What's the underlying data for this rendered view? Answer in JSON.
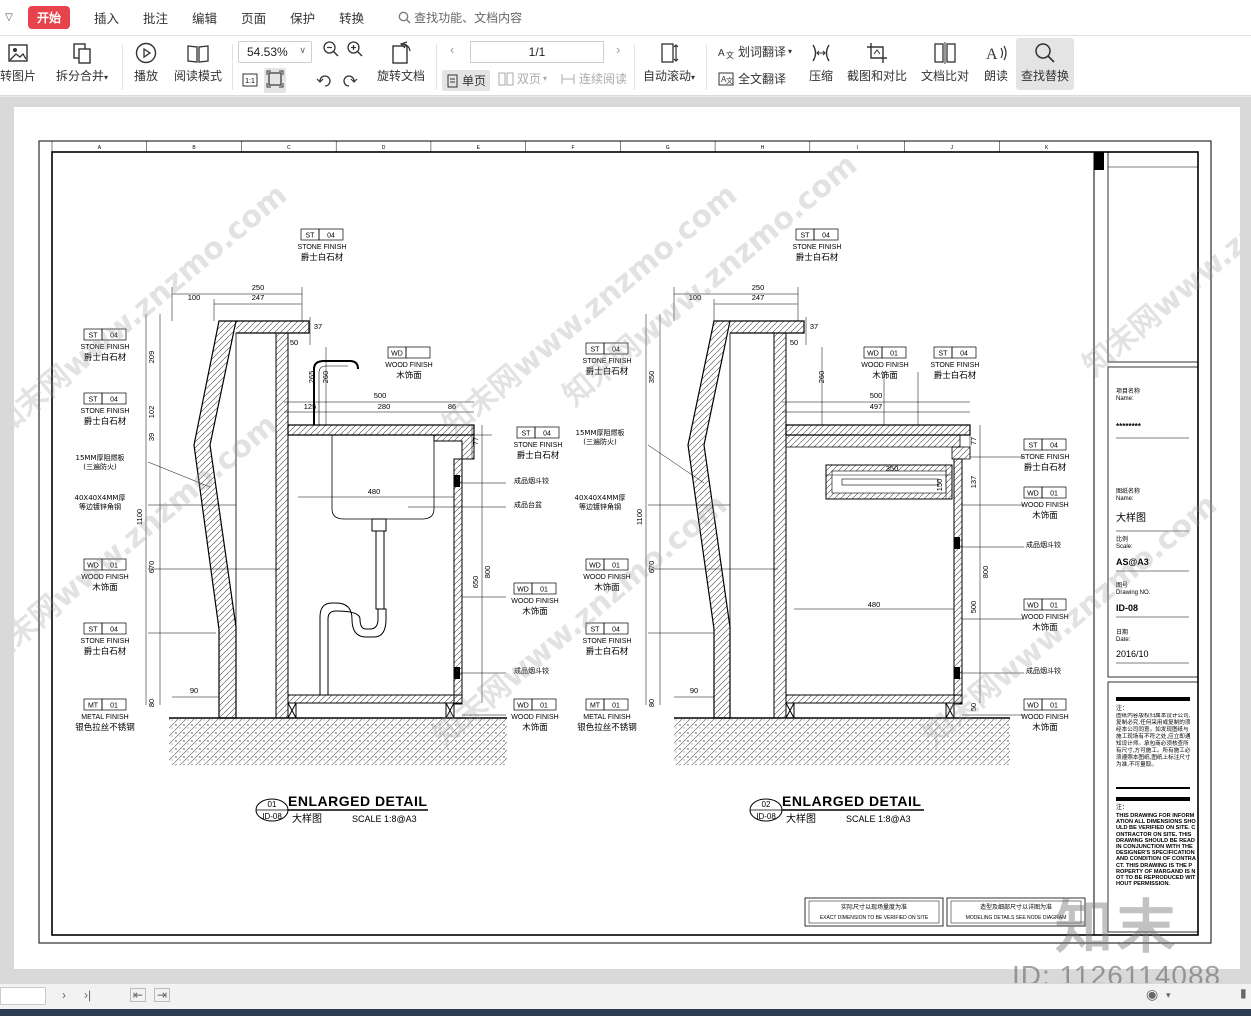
{
  "menubar": {
    "start": "开始",
    "items": [
      "插入",
      "批注",
      "编辑",
      "页面",
      "保护",
      "转换"
    ],
    "search_placeholder": "查找功能、文档内容"
  },
  "ribbon": {
    "to_image": "转图片",
    "split_merge": "拆分合并",
    "play": "播放",
    "read_mode": "阅读模式",
    "zoom": "54.53%",
    "rotate_doc": "旋转文档",
    "page_indicator": "1/1",
    "single_page": "单页",
    "double_page": "双页",
    "continuous": "连续阅读",
    "auto_scroll": "自动滚动",
    "word_translate": "划词翻译",
    "full_translate": "全文翻译",
    "compress": "压缩",
    "screenshot_compare": "截图和对比",
    "doc_compare": "文档比对",
    "read_aloud": "朗读",
    "find_replace": "查找替换"
  },
  "drawing": {
    "grid_letters": [
      "A",
      "B",
      "C",
      "D",
      "E",
      "F",
      "G",
      "H",
      "I",
      "J",
      "K"
    ],
    "watermark": "知末网www.znzmo.com",
    "details": [
      {
        "number": "01",
        "sheet": "ID-08",
        "title": "ENLARGED DETAIL",
        "subtitle": "大样图",
        "scale": "SCALE 1:8@A3",
        "dims": {
          "top_total": "250",
          "top_inner": "247",
          "top_left": "100",
          "h37": "37",
          "w50": "50",
          "w500": "500",
          "w125": "125",
          "w280": "280",
          "w86": "86",
          "w480": "480",
          "h209": "209",
          "h102": "102",
          "h39": "39",
          "h1100": "1100",
          "h670": "670",
          "h80": "80",
          "w90": "90",
          "h800": "800",
          "h650": "650",
          "h77": "77",
          "h265": "265",
          "h260": "260"
        },
        "left_tags": [
          {
            "code": "ST",
            "num": "04",
            "en": "STONE FINISH",
            "cn": "爵士白石材"
          },
          {
            "code": "ST",
            "num": "04",
            "en": "STONE FINISH",
            "cn": "爵士白石材"
          },
          {
            "code": "WD",
            "num": "01",
            "en": "WOOD FINISH",
            "cn": "木饰面"
          },
          {
            "code": "ST",
            "num": "04",
            "en": "STONE FINISH",
            "cn": "爵士白石材"
          },
          {
            "code": "MT",
            "num": "01",
            "en": "METAL FINISH",
            "cn": "银色拉丝不锈钢"
          }
        ],
        "left_notes": [
          "15MM厚阻燃板",
          "(三遍防火)",
          "40X40X4MM厚",
          "等边镀锌角钢"
        ],
        "right_tags": [
          {
            "code": "ST",
            "num": "04",
            "en": "STONE FINISH",
            "cn": "爵士白石材"
          },
          {
            "code": "WD",
            "num": "01",
            "en": "WOOD FINISH",
            "cn": "木饰面"
          },
          {
            "code": "WD",
            "num": "01",
            "en": "WOOD FINISH",
            "cn": "木饰面"
          }
        ],
        "right_notes": [
          "成品烟斗铰",
          "成品台盆",
          "成品烟斗铰"
        ],
        "top_tag": {
          "code": "ST",
          "num": "04",
          "en": "STONE FINISH",
          "cn": "爵士白石材"
        },
        "faucet_tag": {
          "code": "WD",
          "num": "",
          "en": "WOOD FINISH",
          "cn": "木饰面"
        }
      },
      {
        "number": "02",
        "sheet": "ID-08",
        "title": "ENLARGED DETAIL",
        "subtitle": "大样图",
        "scale": "SCALE 1:8@A3",
        "dims": {
          "top_total": "250",
          "top_inner": "247",
          "top_left": "100",
          "h37": "37",
          "w50": "50",
          "w500": "500",
          "w497": "497",
          "w350": "350",
          "w480": "480",
          "h350": "350",
          "h1100": "1100",
          "h670": "670",
          "h80": "80",
          "w90": "90",
          "h800": "800",
          "h500": "500",
          "h77": "77",
          "h137": "137",
          "h150": "150",
          "h50": "50",
          "h260": "260"
        },
        "left_tags": [
          {
            "code": "ST",
            "num": "04",
            "en": "STONE FINISH",
            "cn": "爵士白石材"
          },
          {
            "code": "WD",
            "num": "01",
            "en": "WOOD FINISH",
            "cn": "木饰面"
          },
          {
            "code": "ST",
            "num": "04",
            "en": "STONE FINISH",
            "cn": "爵士白石材"
          },
          {
            "code": "MT",
            "num": "01",
            "en": "METAL FINISH",
            "cn": "银色拉丝不锈钢"
          }
        ],
        "left_notes": [
          "15MM厚阻燃板",
          "(三遍防火)",
          "40X40X4MM厚",
          "等边镀锌角钢"
        ],
        "right_tags": [
          {
            "code": "ST",
            "num": "04",
            "en": "STONE FINISH",
            "cn": "爵士白石材"
          },
          {
            "code": "WD",
            "num": "01",
            "en": "WOOD FINISH",
            "cn": "木饰面"
          },
          {
            "code": "WD",
            "num": "01",
            "en": "WOOD FINISH",
            "cn": "木饰面"
          },
          {
            "code": "WD",
            "num": "01",
            "en": "WOOD FINISH",
            "cn": "木饰面"
          }
        ],
        "right_notes": [
          "成品烟斗铰",
          "成品烟斗铰"
        ],
        "top_tag": {
          "code": "ST",
          "num": "04",
          "en": "STONE FINISH",
          "cn": "爵士白石材"
        },
        "mid_tags": [
          {
            "code": "WD",
            "num": "01",
            "en": "WOOD FINISH",
            "cn": "木饰面"
          },
          {
            "code": "ST",
            "num": "04",
            "en": "STONE FINISH",
            "cn": "爵士白石材"
          }
        ]
      }
    ],
    "title_block": {
      "project_label_cn": "项目名称",
      "project_label_en": "Name:",
      "project_value": "********",
      "drawing_label_cn": "图纸名称",
      "drawing_label_en": "Name:",
      "drawing_value": "大样图",
      "scale_label_cn": "比例",
      "scale_label_en": "Scale:",
      "scale_value": "AS@A3",
      "no_label_cn": "图号",
      "no_label_en": "Drawing NO.",
      "no_value": "ID-08",
      "date_label_cn": "日期",
      "date_label_en": "Date:",
      "date_value": "2016/10",
      "note_label": "注：",
      "note_cn": "图纸内容版权归属本设计公司,复制必究,任何采用或复制的须经本公司同意。如发现图纸与施工现场有不符之处,应立即通知设计师。承包商必须核查所有尺寸,方可施工。所有施工必须遵照本图纸,图纸上标注尺寸为准,不可量取。",
      "note_label2": "注：",
      "note_en": "THIS DRAWING FOR INFORMATION ALL DIMENSIONS SHOULD BE VERIFIED ON SITE. CONTRACTOR ON SITE. THIS DRAWING SHOULD BE READ IN CONJUNCTION WITH THE DESIGNER'S SPECIFICATION AND CONDITION OF CONTRACT. THIS DRAWING IS THE PROPERTY OF MARGAND IS NOT TO BE REPRODUCED WITHOUT PERMISSION.",
      "footer1_cn": "实际尺寸以现场量度为准",
      "footer1_en": "EXACT DIMENSION TO BE VERIFIED ON SITE",
      "footer2_cn": "造型及细部尺寸以详图为准",
      "footer2_en": "MODELING DETAILS SEE NODE DIAGRAM"
    }
  },
  "overlay": {
    "id_watermark": "ID: 1126114088",
    "logo_watermark": "知末"
  }
}
